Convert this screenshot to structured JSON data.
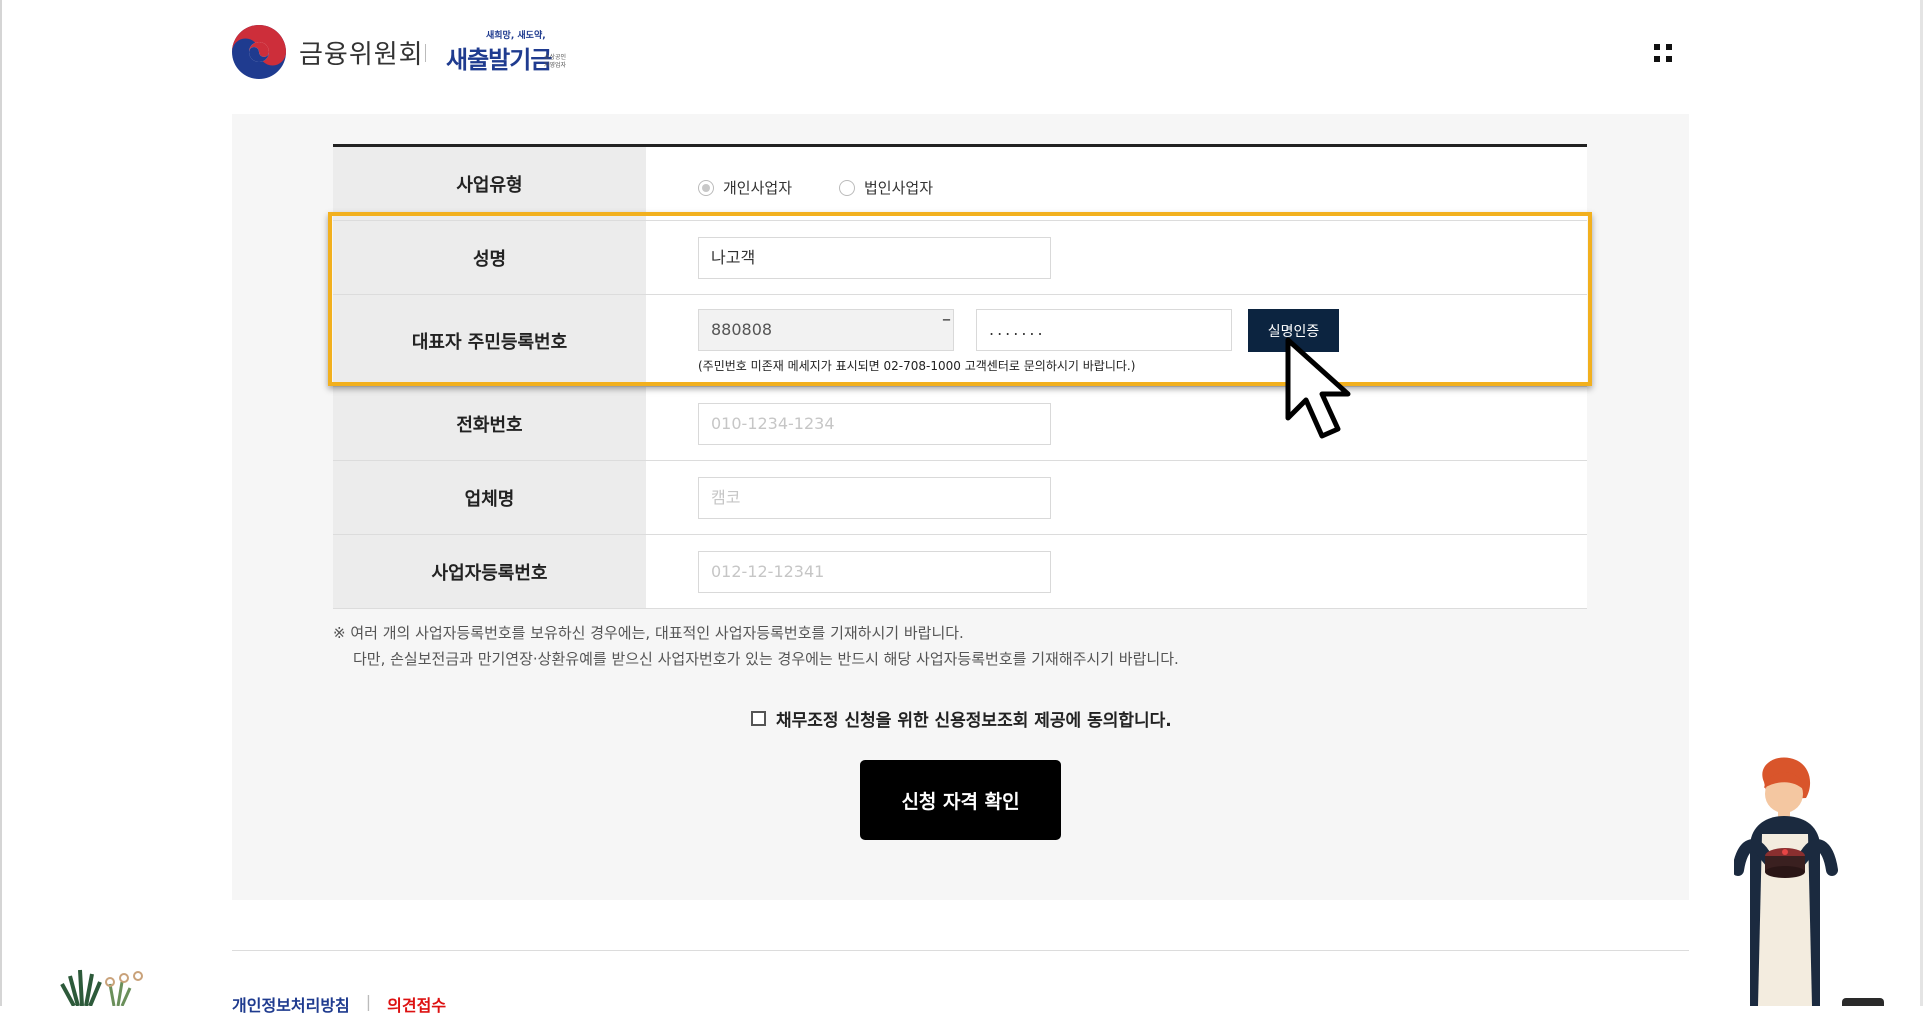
{
  "header": {
    "org_name": "금융위원회",
    "fund_slogan": "새희망, 새도약,",
    "fund_name": "새출발기금",
    "fund_small": "소상공인 자영업자"
  },
  "form": {
    "business_type": {
      "label": "사업유형",
      "options": [
        "개인사업자",
        "법인사업자"
      ],
      "selected": "개인사업자"
    },
    "name": {
      "label": "성명",
      "value": "나고객"
    },
    "resident_number": {
      "label": "대표자 주민등록번호",
      "front_value": "880808",
      "back_value": ".......",
      "dash": "–",
      "verify_button": "실명인증",
      "note": "(주민번호 미존재 메세지가 표시되면 02-708-1000 고객센터로 문의하시기 바랍니다.)"
    },
    "phone": {
      "label": "전화번호",
      "placeholder": "010-1234-1234"
    },
    "company": {
      "label": "업체명",
      "placeholder": "캠코"
    },
    "business_number": {
      "label": "사업자등록번호",
      "placeholder": "012-12-12341"
    }
  },
  "notice": {
    "line1": "※ 여러 개의 사업자등록번호를 보유하신 경우에는, 대표적인 사업자등록번호를 기재하시기 바랍니다.",
    "line2": "다만, 손실보전금과 만기연장·상환유예를 받으신 사업자번호가 있는 경우에는 반드시 해당 사업자등록번호를 기재해주시기 바랍니다."
  },
  "agreement": {
    "label": "채무조정 신청을 위한 신용정보조회 제공에 동의합니다.",
    "checked": false
  },
  "submit_button": "신청 자격 확인",
  "footer": {
    "privacy_link": "개인정보처리방침",
    "separator": "|",
    "opinion_link": "의견접수"
  },
  "colors": {
    "highlight_border": "#f2b01e",
    "verify_button_bg": "#0c2440",
    "submit_bg": "#000000",
    "brand_blue": "#1f3b8f",
    "brand_red": "#cd2e3a"
  }
}
